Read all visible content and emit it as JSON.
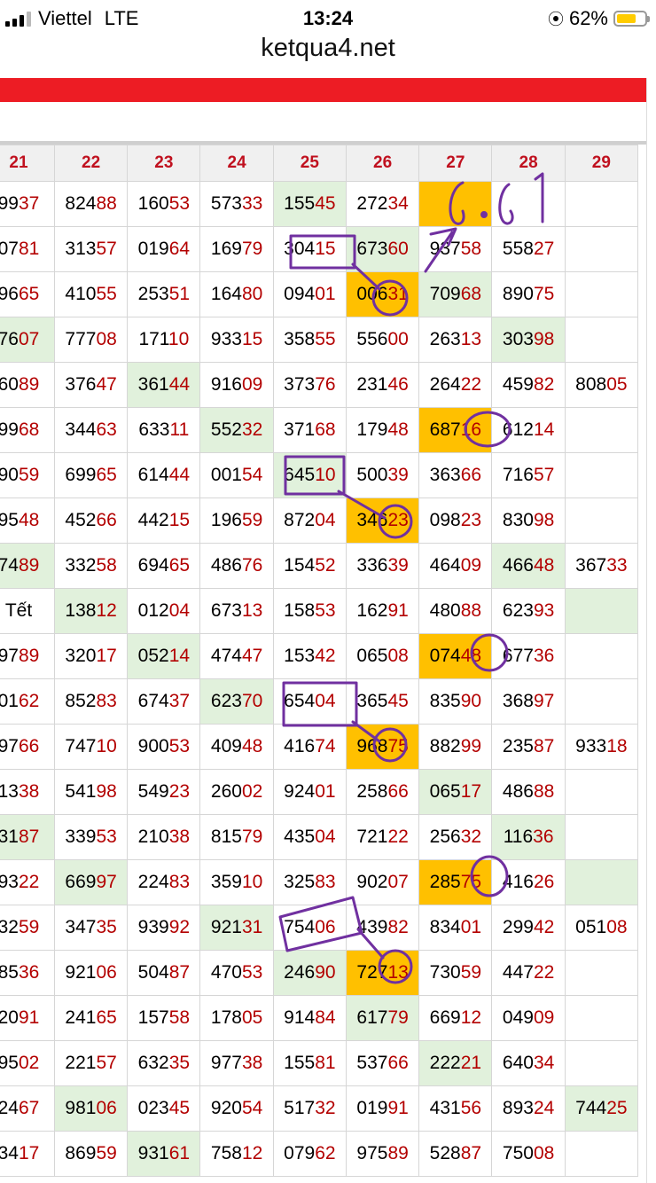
{
  "status": {
    "carrier": "Viettel",
    "network": "LTE",
    "time": "13:24",
    "battery": "62%",
    "battery_level": 0.62
  },
  "browser": {
    "url": "ketqua4.net"
  },
  "table": {
    "headers": [
      "21",
      "22",
      "23",
      "24",
      "25",
      "26",
      "27",
      "28",
      "29"
    ],
    "rows": [
      [
        {
          "h": "99",
          "t": "37"
        },
        {
          "h": "824",
          "t": "88"
        },
        {
          "h": "160",
          "t": "53"
        },
        {
          "h": "573",
          "t": "33"
        },
        {
          "h": "155",
          "t": "45",
          "bg": "g"
        },
        {
          "h": "272",
          "t": "34"
        },
        {
          "h": "",
          "t": "",
          "bg": "y"
        },
        {
          "h": "",
          "t": ""
        },
        {
          "h": "",
          "t": ""
        }
      ],
      [
        {
          "h": "07",
          "t": "81"
        },
        {
          "h": "313",
          "t": "57"
        },
        {
          "h": "019",
          "t": "64"
        },
        {
          "h": "169",
          "t": "79"
        },
        {
          "h": "304",
          "t": "15"
        },
        {
          "h": "673",
          "t": "60",
          "bg": "g"
        },
        {
          "h": "937",
          "t": "58"
        },
        {
          "h": "558",
          "t": "27"
        },
        {
          "h": "",
          "t": ""
        }
      ],
      [
        {
          "h": "96",
          "t": "65"
        },
        {
          "h": "410",
          "t": "55"
        },
        {
          "h": "253",
          "t": "51"
        },
        {
          "h": "164",
          "t": "80"
        },
        {
          "h": "094",
          "t": "01"
        },
        {
          "h": "006",
          "t": "31",
          "bg": "y"
        },
        {
          "h": "709",
          "t": "68",
          "bg": "g"
        },
        {
          "h": "890",
          "t": "75"
        },
        {
          "h": "",
          "t": ""
        }
      ],
      [
        {
          "h": "76",
          "t": "07",
          "bg": "g"
        },
        {
          "h": "777",
          "t": "08"
        },
        {
          "h": "171",
          "t": "10"
        },
        {
          "h": "933",
          "t": "15"
        },
        {
          "h": "358",
          "t": "55"
        },
        {
          "h": "556",
          "t": "00"
        },
        {
          "h": "263",
          "t": "13"
        },
        {
          "h": "303",
          "t": "98",
          "bg": "g"
        },
        {
          "h": "",
          "t": ""
        }
      ],
      [
        {
          "h": "60",
          "t": "89"
        },
        {
          "h": "376",
          "t": "47"
        },
        {
          "h": "361",
          "t": "44",
          "bg": "g"
        },
        {
          "h": "916",
          "t": "09"
        },
        {
          "h": "373",
          "t": "76"
        },
        {
          "h": "231",
          "t": "46"
        },
        {
          "h": "264",
          "t": "22"
        },
        {
          "h": "459",
          "t": "82"
        },
        {
          "h": "808",
          "t": "05"
        }
      ],
      [
        {
          "h": "99",
          "t": "68"
        },
        {
          "h": "344",
          "t": "63"
        },
        {
          "h": "633",
          "t": "11"
        },
        {
          "h": "552",
          "t": "32",
          "bg": "g"
        },
        {
          "h": "371",
          "t": "68"
        },
        {
          "h": "179",
          "t": "48"
        },
        {
          "h": "687",
          "t": "16",
          "bg": "y"
        },
        {
          "h": "612",
          "t": "14"
        },
        {
          "h": "",
          "t": ""
        }
      ],
      [
        {
          "h": "90",
          "t": "59"
        },
        {
          "h": "699",
          "t": "65"
        },
        {
          "h": "614",
          "t": "44"
        },
        {
          "h": "001",
          "t": "54"
        },
        {
          "h": "645",
          "t": "10",
          "bg": "g"
        },
        {
          "h": "500",
          "t": "39"
        },
        {
          "h": "363",
          "t": "66"
        },
        {
          "h": "716",
          "t": "57"
        },
        {
          "h": "",
          "t": ""
        }
      ],
      [
        {
          "h": "95",
          "t": "48"
        },
        {
          "h": "452",
          "t": "66"
        },
        {
          "h": "442",
          "t": "15"
        },
        {
          "h": "196",
          "t": "59"
        },
        {
          "h": "872",
          "t": "04"
        },
        {
          "h": "346",
          "t": "23",
          "bg": "y"
        },
        {
          "h": "098",
          "t": "23"
        },
        {
          "h": "830",
          "t": "98"
        },
        {
          "h": "",
          "t": ""
        }
      ],
      [
        {
          "h": "74",
          "t": "89",
          "bg": "g"
        },
        {
          "h": "332",
          "t": "58"
        },
        {
          "h": "694",
          "t": "65"
        },
        {
          "h": "486",
          "t": "76"
        },
        {
          "h": "154",
          "t": "52"
        },
        {
          "h": "336",
          "t": "39"
        },
        {
          "h": "464",
          "t": "09"
        },
        {
          "h": "466",
          "t": "48",
          "bg": "g"
        },
        {
          "h": "367",
          "t": "33"
        }
      ],
      [
        {
          "h": "Tết",
          "t": ""
        },
        {
          "h": "138",
          "t": "12",
          "bg": "g"
        },
        {
          "h": "012",
          "t": "04"
        },
        {
          "h": "673",
          "t": "13"
        },
        {
          "h": "158",
          "t": "53"
        },
        {
          "h": "162",
          "t": "91"
        },
        {
          "h": "480",
          "t": "88"
        },
        {
          "h": "623",
          "t": "93"
        },
        {
          "h": "",
          "t": "",
          "bg": "g"
        }
      ],
      [
        {
          "h": "97",
          "t": "89"
        },
        {
          "h": "320",
          "t": "17"
        },
        {
          "h": "052",
          "t": "14",
          "bg": "g"
        },
        {
          "h": "474",
          "t": "47"
        },
        {
          "h": "153",
          "t": "42"
        },
        {
          "h": "065",
          "t": "08"
        },
        {
          "h": "074",
          "t": "48",
          "bg": "y"
        },
        {
          "h": "677",
          "t": "36"
        },
        {
          "h": "",
          "t": ""
        }
      ],
      [
        {
          "h": "01",
          "t": "62"
        },
        {
          "h": "852",
          "t": "83"
        },
        {
          "h": "674",
          "t": "37"
        },
        {
          "h": "623",
          "t": "70",
          "bg": "g"
        },
        {
          "h": "654",
          "t": "04"
        },
        {
          "h": "365",
          "t": "45"
        },
        {
          "h": "835",
          "t": "90"
        },
        {
          "h": "368",
          "t": "97"
        },
        {
          "h": "",
          "t": ""
        }
      ],
      [
        {
          "h": "97",
          "t": "66"
        },
        {
          "h": "747",
          "t": "10"
        },
        {
          "h": "900",
          "t": "53"
        },
        {
          "h": "409",
          "t": "48"
        },
        {
          "h": "416",
          "t": "74"
        },
        {
          "h": "968",
          "t": "75",
          "bg": "y"
        },
        {
          "h": "882",
          "t": "99"
        },
        {
          "h": "235",
          "t": "87"
        },
        {
          "h": "933",
          "t": "18"
        }
      ],
      [
        {
          "h": "13",
          "t": "38"
        },
        {
          "h": "541",
          "t": "98"
        },
        {
          "h": "549",
          "t": "23"
        },
        {
          "h": "260",
          "t": "02"
        },
        {
          "h": "924",
          "t": "01"
        },
        {
          "h": "258",
          "t": "66"
        },
        {
          "h": "065",
          "t": "17",
          "bg": "g"
        },
        {
          "h": "486",
          "t": "88"
        },
        {
          "h": "",
          "t": ""
        }
      ],
      [
        {
          "h": "31",
          "t": "87",
          "bg": "g"
        },
        {
          "h": "339",
          "t": "53"
        },
        {
          "h": "210",
          "t": "38"
        },
        {
          "h": "815",
          "t": "79"
        },
        {
          "h": "435",
          "t": "04"
        },
        {
          "h": "721",
          "t": "22"
        },
        {
          "h": "256",
          "t": "32"
        },
        {
          "h": "116",
          "t": "36",
          "bg": "g"
        },
        {
          "h": "",
          "t": ""
        }
      ],
      [
        {
          "h": "93",
          "t": "22"
        },
        {
          "h": "669",
          "t": "97",
          "bg": "g"
        },
        {
          "h": "224",
          "t": "83"
        },
        {
          "h": "359",
          "t": "10"
        },
        {
          "h": "325",
          "t": "83"
        },
        {
          "h": "902",
          "t": "07"
        },
        {
          "h": "285",
          "t": "75",
          "bg": "y"
        },
        {
          "h": "416",
          "t": "26"
        },
        {
          "h": "",
          "t": "",
          "bg": "g"
        }
      ],
      [
        {
          "h": "32",
          "t": "59"
        },
        {
          "h": "347",
          "t": "35"
        },
        {
          "h": "939",
          "t": "92"
        },
        {
          "h": "921",
          "t": "31",
          "bg": "g"
        },
        {
          "h": "754",
          "t": "06"
        },
        {
          "h": "439",
          "t": "82"
        },
        {
          "h": "834",
          "t": "01"
        },
        {
          "h": "299",
          "t": "42"
        },
        {
          "h": "051",
          "t": "08"
        }
      ],
      [
        {
          "h": "85",
          "t": "36"
        },
        {
          "h": "921",
          "t": "06"
        },
        {
          "h": "504",
          "t": "87"
        },
        {
          "h": "470",
          "t": "53"
        },
        {
          "h": "246",
          "t": "90",
          "bg": "g"
        },
        {
          "h": "727",
          "t": "13",
          "bg": "y"
        },
        {
          "h": "730",
          "t": "59"
        },
        {
          "h": "447",
          "t": "22"
        },
        {
          "h": "",
          "t": ""
        }
      ],
      [
        {
          "h": "20",
          "t": "91"
        },
        {
          "h": "241",
          "t": "65"
        },
        {
          "h": "157",
          "t": "58"
        },
        {
          "h": "178",
          "t": "05"
        },
        {
          "h": "914",
          "t": "84"
        },
        {
          "h": "617",
          "t": "79",
          "bg": "g"
        },
        {
          "h": "669",
          "t": "12"
        },
        {
          "h": "049",
          "t": "09"
        },
        {
          "h": "",
          "t": ""
        }
      ],
      [
        {
          "h": "95",
          "t": "02"
        },
        {
          "h": "221",
          "t": "57"
        },
        {
          "h": "632",
          "t": "35"
        },
        {
          "h": "977",
          "t": "38"
        },
        {
          "h": "155",
          "t": "81"
        },
        {
          "h": "537",
          "t": "66"
        },
        {
          "h": "222",
          "t": "21",
          "bg": "g"
        },
        {
          "h": "640",
          "t": "34"
        },
        {
          "h": "",
          "t": ""
        }
      ],
      [
        {
          "h": "24",
          "t": "67"
        },
        {
          "h": "981",
          "t": "06",
          "bg": "g"
        },
        {
          "h": "023",
          "t": "45"
        },
        {
          "h": "920",
          "t": "54"
        },
        {
          "h": "517",
          "t": "32"
        },
        {
          "h": "019",
          "t": "91"
        },
        {
          "h": "431",
          "t": "56"
        },
        {
          "h": "893",
          "t": "24"
        },
        {
          "h": "744",
          "t": "25",
          "bg": "g"
        }
      ],
      [
        {
          "h": "34",
          "t": "17"
        },
        {
          "h": "869",
          "t": "59"
        },
        {
          "h": "931",
          "t": "61",
          "bg": "g"
        },
        {
          "h": "758",
          "t": "12"
        },
        {
          "h": "079",
          "t": "62"
        },
        {
          "h": "975",
          "t": "89"
        },
        {
          "h": "528",
          "t": "87"
        },
        {
          "h": "750",
          "t": "08"
        },
        {
          "h": "",
          "t": ""
        }
      ]
    ]
  },
  "annotation": {
    "text": "6.6 1",
    "color": "#7030a0"
  }
}
